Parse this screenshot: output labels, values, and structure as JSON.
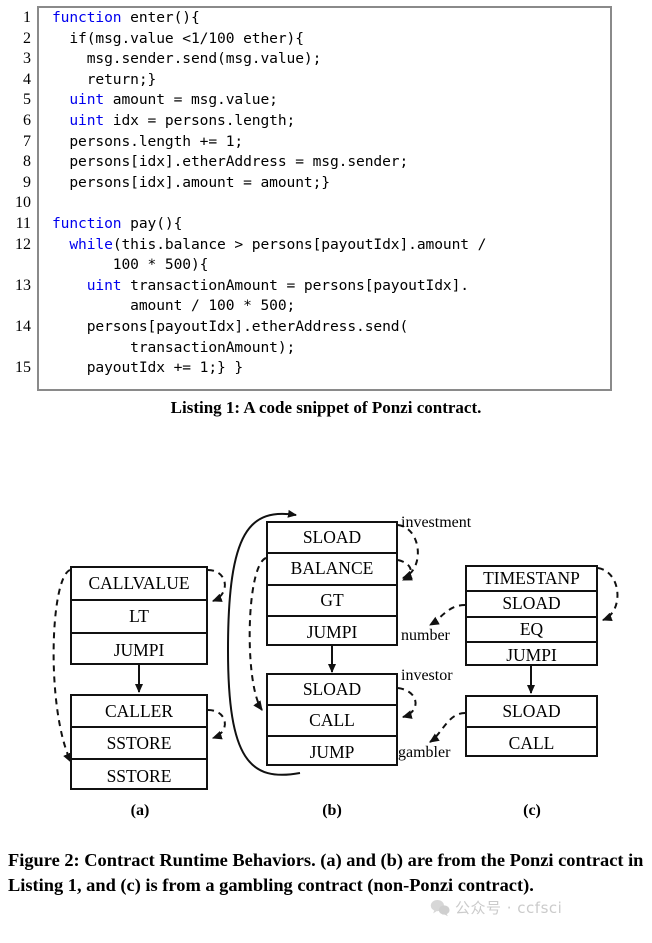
{
  "listing": {
    "caption": "Listing 1: A code snippet of Ponzi contract.",
    "line_numbers": [
      "1",
      "2",
      "3",
      "4",
      "5",
      "6",
      "7",
      "8",
      "9",
      "10",
      "11",
      "12",
      "13",
      "14",
      "15"
    ],
    "lines": [
      {
        "n": "1",
        "segments": [
          {
            "t": "function",
            "kw": true
          },
          {
            "t": " enter(){",
            "kw": false
          }
        ],
        "indent": 0
      },
      {
        "n": "2",
        "segments": [
          {
            "t": "  if(msg.value <1/100 ether){",
            "kw": false
          }
        ],
        "indent": 0
      },
      {
        "n": "3",
        "segments": [
          {
            "t": "    msg.sender.send(msg.value);",
            "kw": false
          }
        ],
        "indent": 0
      },
      {
        "n": "4",
        "segments": [
          {
            "t": "    return;}",
            "kw": false
          }
        ],
        "indent": 0
      },
      {
        "n": "5",
        "segments": [
          {
            "t": "  ",
            "kw": false
          },
          {
            "t": "uint",
            "kw": true
          },
          {
            "t": " amount = msg.value;",
            "kw": false
          }
        ],
        "indent": 0
      },
      {
        "n": "6",
        "segments": [
          {
            "t": "  ",
            "kw": false
          },
          {
            "t": "uint",
            "kw": true
          },
          {
            "t": " idx = persons.length;",
            "kw": false
          }
        ],
        "indent": 0
      },
      {
        "n": "7",
        "segments": [
          {
            "t": "  persons.length += 1;",
            "kw": false
          }
        ],
        "indent": 0
      },
      {
        "n": "8",
        "segments": [
          {
            "t": "  persons[idx].etherAddress = msg.sender;",
            "kw": false
          }
        ],
        "indent": 0
      },
      {
        "n": "9",
        "segments": [
          {
            "t": "  persons[idx].amount = amount;}",
            "kw": false
          }
        ],
        "indent": 0
      },
      {
        "n": "10",
        "segments": [
          {
            "t": "",
            "kw": false
          }
        ],
        "indent": 0
      },
      {
        "n": "11",
        "segments": [
          {
            "t": "function",
            "kw": true
          },
          {
            "t": " pay(){",
            "kw": false
          }
        ],
        "indent": 0
      },
      {
        "n": "12",
        "segments": [
          {
            "t": "  ",
            "kw": false
          },
          {
            "t": "while",
            "kw": true
          },
          {
            "t": "(this.balance > persons[payoutIdx].amount /",
            "kw": false
          }
        ],
        "indent": 0
      },
      {
        "n": "12b",
        "segments": [
          {
            "t": "       100 * 500){",
            "kw": false
          }
        ],
        "indent": 0
      },
      {
        "n": "13",
        "segments": [
          {
            "t": "    ",
            "kw": false
          },
          {
            "t": "uint",
            "kw": true
          },
          {
            "t": " transactionAmount = persons[payoutIdx].",
            "kw": false
          }
        ],
        "indent": 0
      },
      {
        "n": "13b",
        "segments": [
          {
            "t": "         amount / 100 * 500;",
            "kw": false
          }
        ],
        "indent": 0
      },
      {
        "n": "14",
        "segments": [
          {
            "t": "    persons[payoutIdx].etherAddress.send(",
            "kw": false
          }
        ],
        "indent": 0
      },
      {
        "n": "14b",
        "segments": [
          {
            "t": "         transactionAmount);",
            "kw": false
          }
        ],
        "indent": 0
      },
      {
        "n": "15",
        "segments": [
          {
            "t": "    payoutIdx += 1;} }",
            "kw": false
          }
        ],
        "indent": 0
      }
    ],
    "raw_code": "function enter(){\n  if(msg.value <1/100 ether){\n    msg.sender.send(msg.value);\n    return;}\n  uint amount = msg.value;\n  uint idx = persons.length;\n  persons.length += 1;\n  persons[idx].etherAddress = msg.sender;\n  persons[idx].amount = amount;}\n\nfunction pay(){\n  while(this.balance > persons[payoutIdx].amount /\n       100 * 500){\n    uint transactionAmount = persons[payoutIdx].\n         amount / 100 * 500;\n    persons[payoutIdx].etherAddress.send(\n         transactionAmount);\n    payoutIdx += 1;} }",
    "keyword_color": "#0000EE",
    "text_color": "#000000",
    "border_color": "#8A8A8A"
  },
  "figure": {
    "caption": "Figure 2: Contract Runtime Behaviors. (a) and (b) are from the Ponzi contract in Listing 1, and (c) is from a gambling contract (non-Ponzi contract).",
    "sublabels": [
      "(a)",
      "(b)",
      "(c)"
    ],
    "diagrams": [
      {
        "id": "a",
        "label": "(a)",
        "blocks": [
          {
            "ops": [
              "CALLVALUE",
              "LT",
              "JUMPI"
            ]
          },
          {
            "ops": [
              "CALLER",
              "SSTORE",
              "SSTORE"
            ]
          }
        ],
        "edge_labels": []
      },
      {
        "id": "b",
        "label": "(b)",
        "blocks": [
          {
            "ops": [
              "SLOAD",
              "BALANCE",
              "GT",
              "JUMPI"
            ]
          },
          {
            "ops": [
              "SLOAD",
              "CALL",
              "JUMP"
            ]
          }
        ],
        "edge_labels": [
          "investment",
          "investor"
        ]
      },
      {
        "id": "c",
        "label": "(c)",
        "blocks": [
          {
            "ops": [
              "TIMESTANP",
              "SLOAD",
              "EQ",
              "JUMPI"
            ]
          },
          {
            "ops": [
              "SLOAD",
              "CALL"
            ]
          }
        ],
        "edge_labels": [
          "number",
          "gambler"
        ]
      }
    ],
    "all_edge_labels": [
      "investment",
      "number",
      "investor",
      "gambler"
    ]
  },
  "watermark": {
    "text": "公众号 · ccfsci",
    "icon": "wechat-icon",
    "color": "#B8B8B8"
  }
}
